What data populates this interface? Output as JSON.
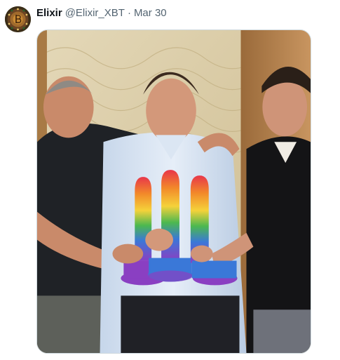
{
  "tweet": {
    "display_name": "Elixir",
    "handle": "@Elixir_XBT",
    "separator": "·",
    "date": "Mar 30"
  },
  "avatar": {
    "icon": "bitcoin-emblem-avatar"
  },
  "media": {
    "type": "photo"
  },
  "colors": {
    "name": "#0f1419",
    "meta": "#536471",
    "border": "#cfd9de",
    "wall": "#d8c9a4",
    "door": "#b8844f"
  }
}
